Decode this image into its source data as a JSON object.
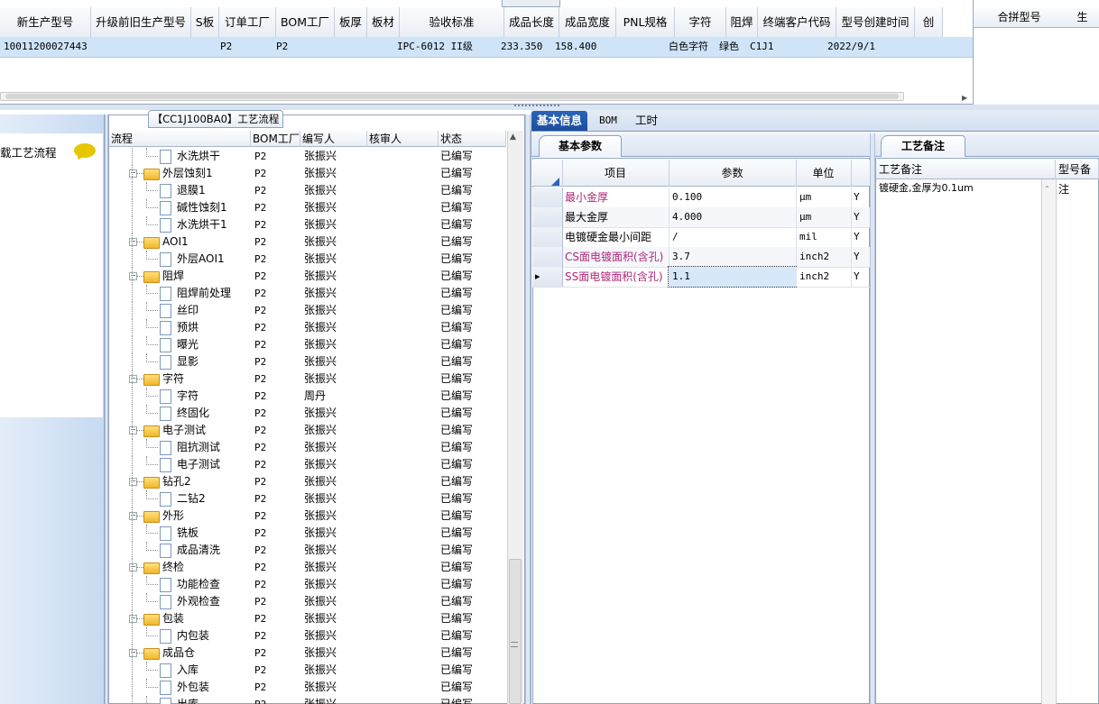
{
  "top_grid": {
    "headers": [
      "新生产型号",
      "升级前旧生产型号",
      "S板",
      "订单工厂",
      "BOM工厂",
      "板厚",
      "板材",
      "验收标准",
      "成品长度",
      "成品宽度",
      "PNL规格",
      "字符",
      "阻焊",
      "终端客户代码",
      "型号创建时间",
      "创"
    ],
    "row": [
      "10011200027443",
      "",
      "",
      "P2",
      "P2",
      "",
      "",
      "IPC-6012 II级",
      "233.350",
      "158.400",
      "",
      "白色字符",
      "绿色",
      "C1J1",
      "2022/9/1",
      ""
    ]
  },
  "right_grid": {
    "headers": [
      "合拼型号",
      "生"
    ]
  },
  "left_panel": {
    "item_label": "载工艺流程",
    "chat_icon": "speech-bubble-icon"
  },
  "tree": {
    "tab_title": "【CC1J100BA0】工艺流程",
    "headers": {
      "flow": "流程",
      "bom": "BOM工厂",
      "writer": "编写人",
      "reviewer": "核审人",
      "status": "状态"
    },
    "rows": [
      {
        "name": "水洗烘干",
        "level": 2,
        "bom": "P2",
        "writer": "张振兴",
        "status": "已编写"
      },
      {
        "name": "外层蚀刻1",
        "level": 1,
        "bom": "P2",
        "writer": "张振兴",
        "status": "已编写"
      },
      {
        "name": "退膜1",
        "level": 2,
        "bom": "P2",
        "writer": "张振兴",
        "status": "已编写"
      },
      {
        "name": "碱性蚀刻1",
        "level": 2,
        "bom": "P2",
        "writer": "张振兴",
        "status": "已编写"
      },
      {
        "name": "水洗烘干1",
        "level": 2,
        "bom": "P2",
        "writer": "张振兴",
        "status": "已编写"
      },
      {
        "name": "AOI1",
        "level": 1,
        "bom": "P2",
        "writer": "张振兴",
        "status": "已编写"
      },
      {
        "name": "外层AOI1",
        "level": 2,
        "bom": "P2",
        "writer": "张振兴",
        "status": "已编写"
      },
      {
        "name": "阻焊",
        "level": 1,
        "bom": "P2",
        "writer": "张振兴",
        "status": "已编写"
      },
      {
        "name": "阻焊前处理",
        "level": 2,
        "bom": "P2",
        "writer": "张振兴",
        "status": "已编写"
      },
      {
        "name": "丝印",
        "level": 2,
        "bom": "P2",
        "writer": "张振兴",
        "status": "已编写"
      },
      {
        "name": "预烘",
        "level": 2,
        "bom": "P2",
        "writer": "张振兴",
        "status": "已编写"
      },
      {
        "name": "曝光",
        "level": 2,
        "bom": "P2",
        "writer": "张振兴",
        "status": "已编写"
      },
      {
        "name": "显影",
        "level": 2,
        "bom": "P2",
        "writer": "张振兴",
        "status": "已编写"
      },
      {
        "name": "字符",
        "level": 1,
        "bom": "P2",
        "writer": "张振兴",
        "status": "已编写"
      },
      {
        "name": "字符",
        "level": 2,
        "bom": "P2",
        "writer": "周丹",
        "status": "已编写"
      },
      {
        "name": "终固化",
        "level": 2,
        "bom": "P2",
        "writer": "张振兴",
        "status": "已编写"
      },
      {
        "name": "电子测试",
        "level": 1,
        "bom": "P2",
        "writer": "张振兴",
        "status": "已编写"
      },
      {
        "name": "阻抗测试",
        "level": 2,
        "bom": "P2",
        "writer": "张振兴",
        "status": "已编写"
      },
      {
        "name": "电子测试",
        "level": 2,
        "bom": "P2",
        "writer": "张振兴",
        "status": "已编写"
      },
      {
        "name": "钻孔2",
        "level": 1,
        "bom": "P2",
        "writer": "张振兴",
        "status": "已编写"
      },
      {
        "name": "二钻2",
        "level": 2,
        "bom": "P2",
        "writer": "张振兴",
        "status": "已编写"
      },
      {
        "name": "外形",
        "level": 1,
        "bom": "P2",
        "writer": "张振兴",
        "status": "已编写"
      },
      {
        "name": "铣板",
        "level": 2,
        "bom": "P2",
        "writer": "张振兴",
        "status": "已编写"
      },
      {
        "name": "成品清洗",
        "level": 2,
        "bom": "P2",
        "writer": "张振兴",
        "status": "已编写"
      },
      {
        "name": "终检",
        "level": 1,
        "bom": "P2",
        "writer": "张振兴",
        "status": "已编写"
      },
      {
        "name": "功能检查",
        "level": 2,
        "bom": "P2",
        "writer": "张振兴",
        "status": "已编写"
      },
      {
        "name": "外观检查",
        "level": 2,
        "bom": "P2",
        "writer": "张振兴",
        "status": "已编写"
      },
      {
        "name": "包装",
        "level": 1,
        "bom": "P2",
        "writer": "张振兴",
        "status": "已编写"
      },
      {
        "name": "内包装",
        "level": 2,
        "bom": "P2",
        "writer": "张振兴",
        "status": "已编写"
      },
      {
        "name": "成品仓",
        "level": 1,
        "bom": "P2",
        "writer": "张振兴",
        "status": "已编写"
      },
      {
        "name": "入库",
        "level": 2,
        "bom": "P2",
        "writer": "张振兴",
        "status": "已编写"
      },
      {
        "name": "外包装",
        "level": 2,
        "bom": "P2",
        "writer": "张振兴",
        "status": "已编写"
      },
      {
        "name": "出库",
        "level": 2,
        "bom": "P2",
        "writer": "张振兴",
        "status": "已编写"
      }
    ]
  },
  "tabs": [
    "基本信息",
    "BOM",
    "工时"
  ],
  "basic_params": {
    "subtab": "基本参数",
    "headers": {
      "item": "项目",
      "param": "参数",
      "unit": "单位"
    },
    "rows": [
      {
        "item": "最小金厚",
        "param": "0.100",
        "unit": "μm",
        "flag": "Y",
        "pink": true
      },
      {
        "item": "最大金厚",
        "param": "4.000",
        "unit": "μm",
        "flag": "Y",
        "pink": false
      },
      {
        "item": "电镀硬金最小间距",
        "param": "/",
        "unit": "mil",
        "flag": "Y",
        "pink": false
      },
      {
        "item": "CS面电镀面积(含孔)",
        "param": "3.7",
        "unit": "inch2",
        "flag": "Y",
        "pink": true
      },
      {
        "item": "SS面电镀面积(含孔)",
        "param": "1.1",
        "unit": "inch2",
        "flag": "Y",
        "pink": true,
        "current": true
      }
    ]
  },
  "notes": {
    "subtab": "工艺备注",
    "headers": {
      "note": "工艺备注",
      "model_note": "型号备注"
    },
    "text": "镀硬金,金厚为0.1um"
  },
  "colors": {
    "accent": "#1b4f9d",
    "selected_row": "#cfe4f8",
    "pink_text": "#b0287a"
  }
}
